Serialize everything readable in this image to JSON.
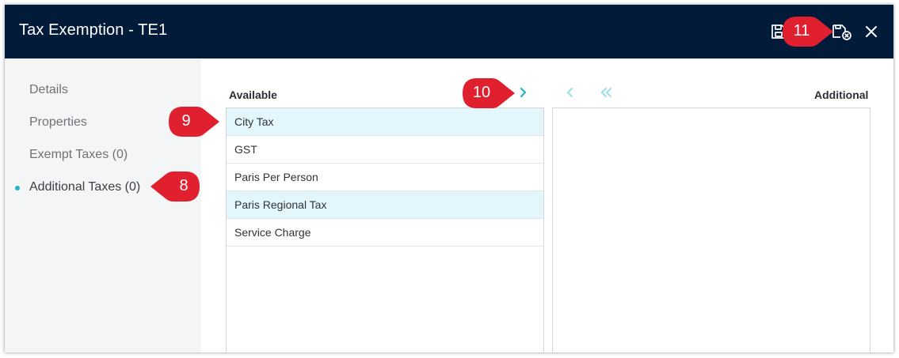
{
  "window": {
    "title": "Tax Exemption - TE1"
  },
  "header_icons": [
    "save-icon",
    "save-close-icon",
    "close-icon"
  ],
  "sidebar": {
    "items": [
      {
        "label": "Details"
      },
      {
        "label": "Properties"
      },
      {
        "label": "Exempt Taxes (0)"
      },
      {
        "label": "Additional Taxes (0)"
      }
    ]
  },
  "available": {
    "label": "Available",
    "items": [
      "City Tax",
      "GST",
      "Paris Per Person",
      "Paris Regional Tax",
      "Service Charge"
    ],
    "selected": [
      "City Tax",
      "Paris Regional Tax"
    ]
  },
  "additional": {
    "label": "Additional",
    "items": []
  },
  "callouts": {
    "c8": "8",
    "c9": "9",
    "c10": "10",
    "c11": "11"
  },
  "colors": {
    "header_bg": "#021b38",
    "accent": "#1fb6c8",
    "selected_row": "#e3f6fb",
    "callout": "#e0202f"
  }
}
